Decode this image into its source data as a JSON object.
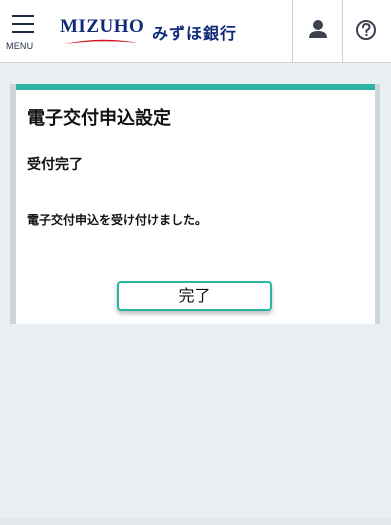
{
  "header": {
    "menu_label": "MENU",
    "logo_en": "MIZUHO",
    "logo_ja": "みずほ銀行",
    "brand_color": "#102a7a",
    "swoosh_color": "#d1121c"
  },
  "card": {
    "accent_color": "#2bb3a3",
    "title": "電子交付申込設定",
    "subtitle": "受付完了",
    "message": "電子交付申込を受け付けました。",
    "done_button": "完了"
  }
}
